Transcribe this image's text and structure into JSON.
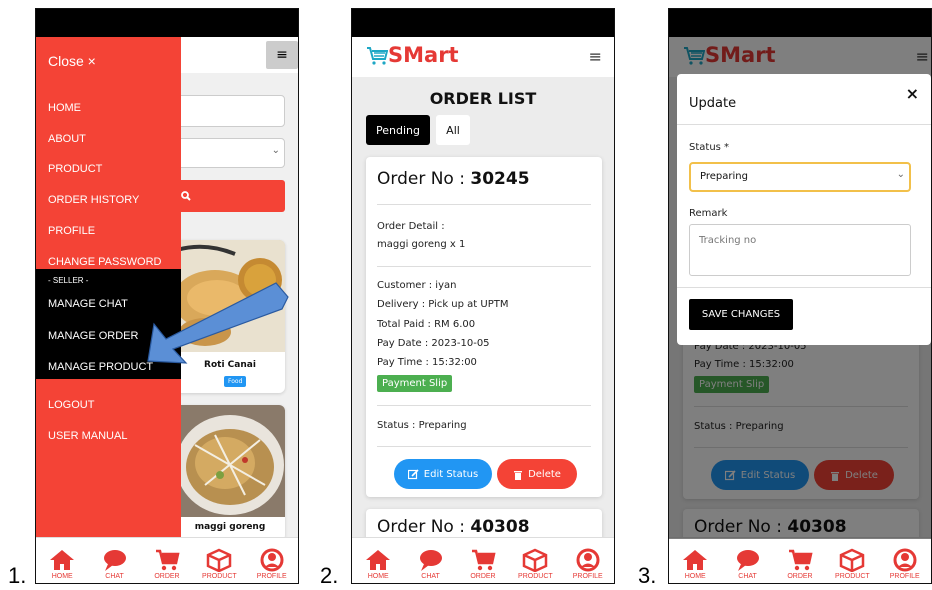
{
  "labels": {
    "one": "1.",
    "two": "2.",
    "three": "3."
  },
  "bottom_nav": [
    "HOME",
    "CHAT",
    "ORDER",
    "PRODUCT",
    "PROFILE"
  ],
  "accent": "#f44336",
  "phone1": {
    "close": "Close ×",
    "menu": [
      "HOME",
      "ABOUT",
      "PRODUCT",
      "ORDER HISTORY",
      "PROFILE",
      "CHANGE PASSWORD"
    ],
    "seller_header": "- SELLER -",
    "seller_menu": [
      "MANAGE CHAT",
      "MANAGE ORDER",
      "MANAGE PRODUCT"
    ],
    "bottom_menu": [
      "LOGOUT",
      "USER MANUAL"
    ],
    "products": [
      {
        "name": "Roti Canai",
        "tag": "Food"
      },
      {
        "name": "maggi goreng"
      }
    ]
  },
  "phone2": {
    "brand": "SMart",
    "title": "ORDER LIST",
    "tabs": [
      "Pending",
      "All"
    ],
    "order": {
      "no_label": "Order No : ",
      "no": "30245",
      "detail_label": "Order Detail :",
      "detail": "maggi goreng x 1",
      "customer": "Customer : iyan",
      "delivery": "Delivery : Pick up at UPTM",
      "total": "Total Paid : RM 6.00",
      "pay_date": "Pay Date : 2023-10-05",
      "pay_time": "Pay Time : 15:32:00",
      "slip": "Payment Slip",
      "status": "Status : Preparing",
      "edit": "Edit Status",
      "delete": "Delete"
    },
    "next_order_label": "Order No : ",
    "next_order_no": "40308"
  },
  "phone3": {
    "brand": "SMart",
    "modal": {
      "title": "Update",
      "close": "×",
      "status_label": "Status *",
      "status_value": "Preparing",
      "remark_label": "Remark",
      "remark_placeholder": "Tracking no",
      "save": "SAVE CHANGES"
    },
    "pay_date_partial": "Pay Date : 2023-10-05",
    "pay_time": "Pay Time : 15:32:00",
    "slip": "Payment Slip",
    "status": "Status : Preparing",
    "edit": "Edit Status",
    "delete": "Delete",
    "next_order_label": "Order No : ",
    "next_order_no": "40308"
  }
}
